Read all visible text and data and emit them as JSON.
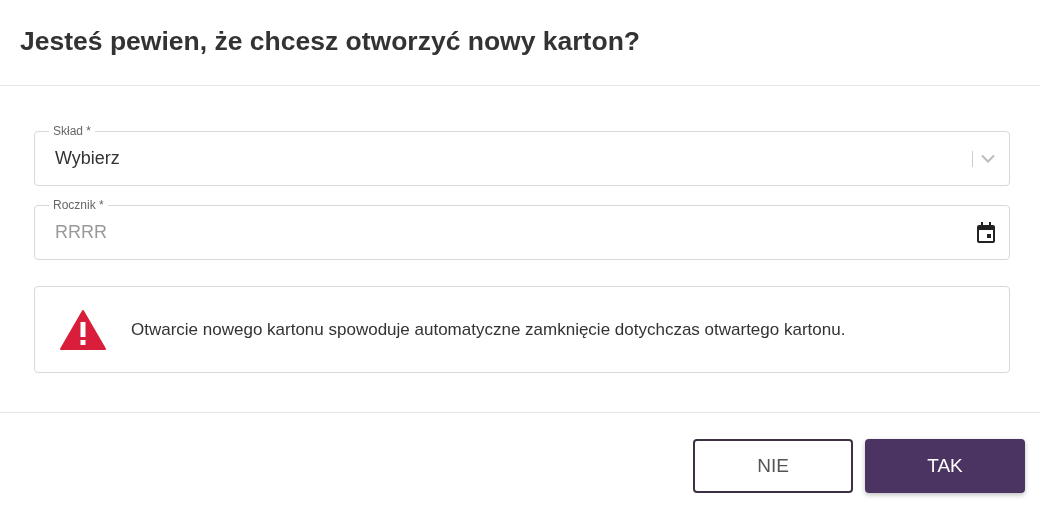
{
  "dialog": {
    "title": "Jesteś pewien, że chcesz otworzyć nowy karton?"
  },
  "fields": [
    {
      "kind": "select",
      "label": "Skład *",
      "value": "Wybierz"
    },
    {
      "kind": "date",
      "label": "Rocznik *",
      "placeholder": "RRRR"
    }
  ],
  "alert": {
    "kind": "warning",
    "message": "Otwarcie nowego kartonu spowoduje automatyczne zamknięcie dotychczas otwartego kartonu."
  },
  "buttons": [
    {
      "label": "NIE",
      "kind": "outlined"
    },
    {
      "label": "TAK",
      "kind": "primary"
    }
  ]
}
